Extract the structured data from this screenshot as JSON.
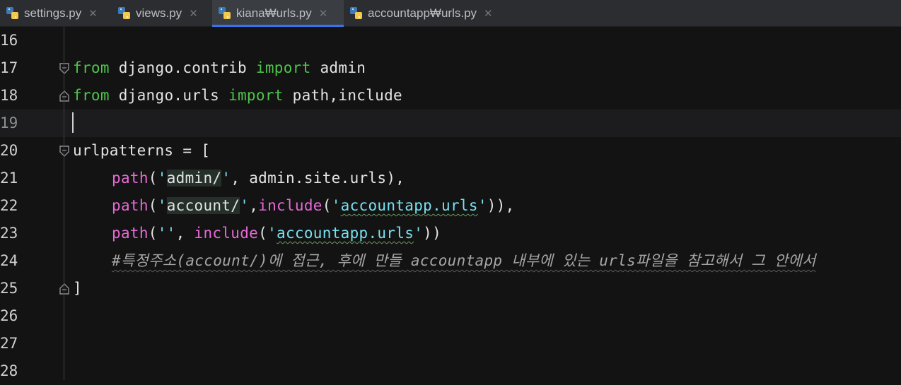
{
  "tabs": [
    {
      "label": "settings.py",
      "icon": "python-file-icon",
      "active": false
    },
    {
      "label": "views.py",
      "icon": "python-file-icon",
      "active": false
    },
    {
      "label": "kiana₩urls.py",
      "icon": "python-file-icon",
      "active": true
    },
    {
      "label": "accountapp₩urls.py",
      "icon": "python-file-icon",
      "active": false
    }
  ],
  "close_glyph": "✕",
  "colors": {
    "keyword": "#4ec64b",
    "function": "#e76ad6",
    "string": "#78e1f0",
    "comment": "#a6a6a6",
    "active_tab_underline": "#3574f0"
  },
  "editor": {
    "current_line": "19",
    "lines": [
      {
        "num": "16",
        "code": ""
      },
      {
        "num": "17",
        "kw": "from",
        "rest": " django.contrib ",
        "kw2": "import",
        "rest2": " admin"
      },
      {
        "num": "18",
        "kw": "from",
        "rest": " django.urls ",
        "kw2": "import",
        "rest2": " path,include"
      },
      {
        "num": "19",
        "code": ""
      },
      {
        "num": "20",
        "code": "urlpatterns = ["
      },
      {
        "num": "21",
        "fn": "path",
        "p1": "(",
        "q1": "'",
        "s1": "admin/",
        "q2": "'",
        "rest": ", admin.site.urls),"
      },
      {
        "num": "22",
        "fn": "path",
        "p1": "(",
        "q1": "'",
        "s1": "account/",
        "q2": "'",
        "sep": ",",
        "fn2": "include",
        "p2": "(",
        "q3": "'",
        "s2": "accountapp.urls",
        "q4": "'",
        "rest": ")),"
      },
      {
        "num": "23",
        "fn": "path",
        "p1": "(",
        "s0": "''",
        "sep": ", ",
        "fn2": "include",
        "p2": "(",
        "q3": "'",
        "s2": "accountapp.urls",
        "q4": "'",
        "rest": "))"
      },
      {
        "num": "24",
        "comment": "#특정주소(account/)에 접근, 후에 만들 accountapp 내부에 있는 urls파일을 참고해서 그 안에서"
      },
      {
        "num": "25",
        "code": "]"
      },
      {
        "num": "26",
        "code": ""
      },
      {
        "num": "27",
        "code": ""
      },
      {
        "num": "28",
        "code": ""
      }
    ]
  }
}
